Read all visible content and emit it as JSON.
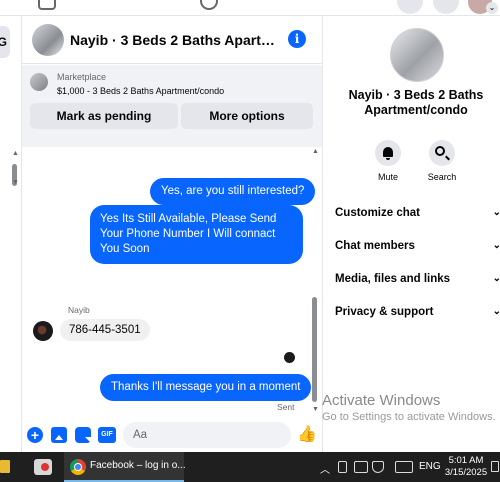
{
  "header": {
    "title": "Nayib · 3 Beds 2 Baths Apartment/condo"
  },
  "listing": {
    "source": "Marketplace",
    "price_title": "$1,000 - 3 Beds 2 Baths Apartment/condo",
    "actions": [
      "Mark as pending",
      "More options"
    ]
  },
  "messages": [
    {
      "from": "me",
      "text": "Yes, are you still interested?"
    },
    {
      "from": "me",
      "text": "Yes Its Still Available, Please Send Your Phone Number I Will connact You Soon"
    },
    {
      "from": "Nayib",
      "sender_label": "Nayib",
      "text": "786-445-3501"
    },
    {
      "from": "me",
      "text": "Thanks I'll message you in a moment",
      "status": "Sent"
    }
  ],
  "composer": {
    "placeholder": "Aa",
    "gif_label": "GIF"
  },
  "details": {
    "name": "Nayib · 3 Beds 2 Baths Apartment/condo",
    "actions": [
      {
        "label": "Mute",
        "icon": "bell-icon"
      },
      {
        "label": "Search",
        "icon": "search-icon"
      }
    ],
    "sections": [
      "Customize chat",
      "Chat members",
      "Media, files and links",
      "Privacy & support"
    ]
  },
  "watermark": {
    "title": "Activate Windows",
    "subtitle": "Go to Settings to activate Windows."
  },
  "taskbar": {
    "active_app": "Facebook – log in o...",
    "language": "ENG",
    "time": "5:01 AM",
    "date": "3/15/2025"
  },
  "colors": {
    "accent": "#0866ff",
    "bubble_in": "#f0f0f0",
    "taskbar": "#1f1f1f"
  }
}
